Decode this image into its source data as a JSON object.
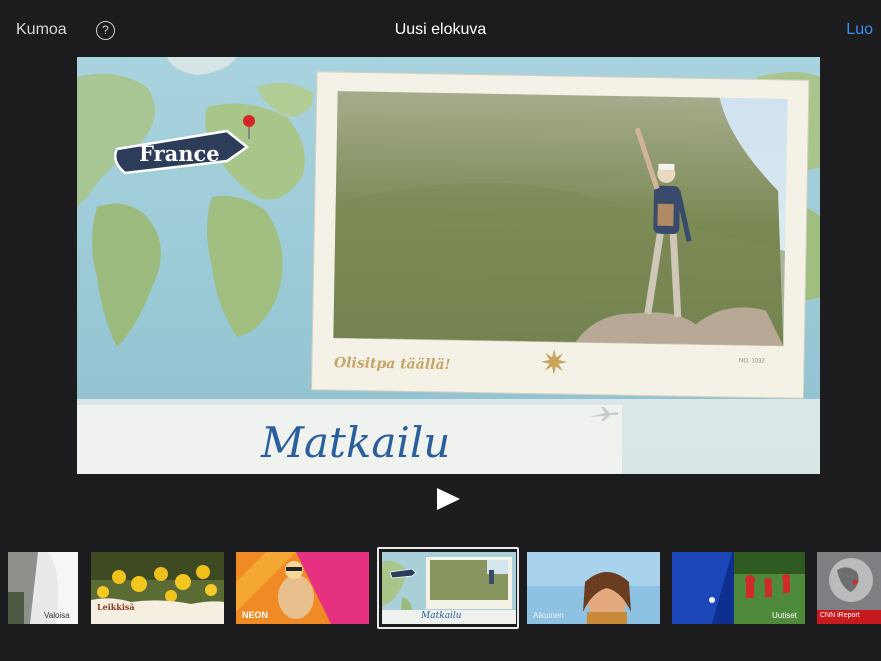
{
  "topbar": {
    "undo_label": "Kumoa",
    "help_glyph": "?",
    "help_icon": "question-circle-icon",
    "title": "Uusi elokuva",
    "create_label": "Luo"
  },
  "preview": {
    "pin_label": "France",
    "postcard_caption": "Olisitpa täällä!",
    "postcard_number": "NO. 1032",
    "title_script": "Matkailu",
    "pin_icon": "map-pin-icon",
    "compass_icon": "compass-star-icon",
    "plane_icon": "airplane-icon"
  },
  "player": {
    "play_icon": "play-icon"
  },
  "themes": [
    {
      "label": "Valoisa"
    },
    {
      "label": "Leikkisä"
    },
    {
      "label": "NEON"
    },
    {
      "label": "Matkailu",
      "selected": true
    },
    {
      "label": "Aikuinen"
    },
    {
      "label": "Uutiset"
    },
    {
      "label": "CNN iReport"
    }
  ],
  "colors": {
    "background": "#1c1c1e",
    "accent": "#3a8ff0",
    "pin_badge": "#2d3c58",
    "script_title": "#2a5e9c"
  }
}
